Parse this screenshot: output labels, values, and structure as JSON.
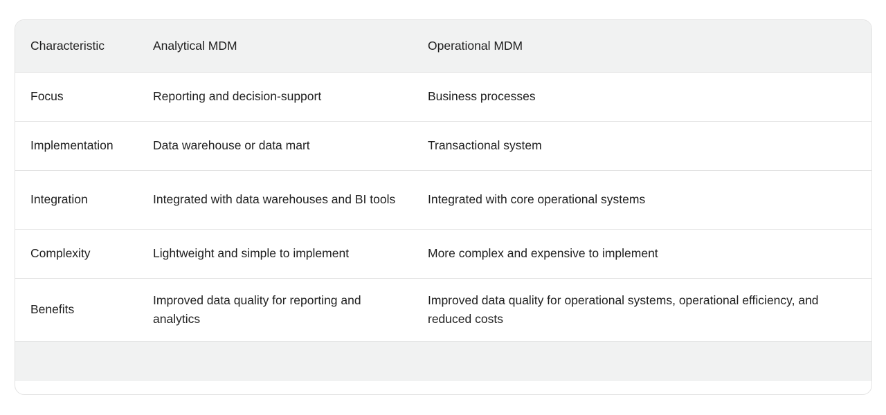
{
  "table": {
    "columns": [
      {
        "key": "characteristic",
        "label": "Characteristic"
      },
      {
        "key": "analytical",
        "label": "Analytical MDM"
      },
      {
        "key": "operational",
        "label": "Operational MDM"
      }
    ],
    "rows": [
      {
        "characteristic": "Focus",
        "analytical": "Reporting and decision-support",
        "operational": "Business processes"
      },
      {
        "characteristic": "Implementation",
        "analytical": "Data warehouse or data mart",
        "operational": "Transactional system"
      },
      {
        "characteristic": "Integration",
        "analytical": "Integrated with data warehouses and BI tools",
        "operational": "Integrated with core operational systems"
      },
      {
        "characteristic": "Complexity",
        "analytical": "Lightweight and simple to implement",
        "operational": "More complex and expensive to implement"
      },
      {
        "characteristic": "Benefits",
        "analytical": "Improved data quality for reporting and analytics",
        "operational": "Improved data quality for operational systems, operational efficiency, and reduced costs"
      }
    ],
    "footer": {
      "characteristic": "",
      "analytical": "",
      "operational": ""
    },
    "colors": {
      "header_background": "#f1f2f2",
      "footer_background": "#f1f2f2",
      "row_background": "#ffffff",
      "border": "#e3e3e3",
      "text": "#1f1f1f",
      "page_background": "#ffffff"
    }
  }
}
